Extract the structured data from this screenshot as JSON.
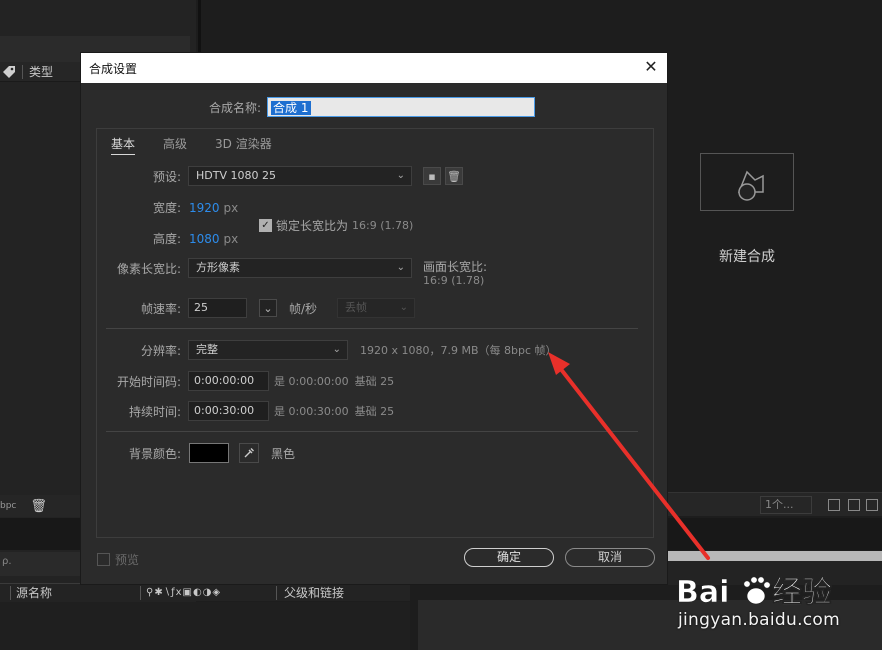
{
  "background": {
    "type_header": "类型",
    "bpc_label": "bpc",
    "timeline_col_source": "源名称",
    "timeline_col_parent": "父级和链接",
    "toolbar_dropdown": "1个...",
    "new_comp_label": "新建合成",
    "search_hint": "ρ."
  },
  "dialog": {
    "title": "合成设置",
    "name_label": "合成名称:",
    "name_value": "合成 1",
    "tabs": [
      {
        "label": "基本",
        "active": true
      },
      {
        "label": "高级",
        "active": false
      },
      {
        "label": "3D 渲染器",
        "active": false
      }
    ],
    "preset": {
      "label": "预设:",
      "value": "HDTV 1080 25"
    },
    "width": {
      "label": "宽度:",
      "value": "1920",
      "unit": "px"
    },
    "height": {
      "label": "高度:",
      "value": "1080",
      "unit": "px"
    },
    "lock_aspect": {
      "label": "锁定长宽比为",
      "value": "16:9 (1.78)",
      "checked": true
    },
    "pixel_aspect": {
      "label": "像素长宽比:",
      "value": "方形像素"
    },
    "frame_aspect": {
      "label": "画面长宽比:",
      "value": "16:9 (1.78)"
    },
    "frame_rate": {
      "label": "帧速率:",
      "value": "25",
      "unit": "帧/秒",
      "drop_frame": "丢帧"
    },
    "resolution": {
      "label": "分辨率:",
      "value": "完整",
      "info": "1920 x 1080，7.9 MB（每 8bpc 帧）"
    },
    "start_timecode": {
      "label": "开始时间码:",
      "value": "0:00:00:00",
      "info_is": "是 0:00:00:00",
      "info_base": "基础 25"
    },
    "duration": {
      "label": "持续时间:",
      "value": "0:00:30:00",
      "info_is": "是 0:00:30:00",
      "info_base": "基础 25"
    },
    "bg_color": {
      "label": "背景颜色:",
      "name": "黑色",
      "color": "#000000"
    },
    "preview_label": "预览",
    "ok_label": "确定",
    "cancel_label": "取消"
  },
  "watermark": {
    "brand": "Baidu经验",
    "url": "jingyan.baidu.com"
  },
  "colors": {
    "accent_blue": "#2d8ceb",
    "annotation_red": "#e8302a"
  }
}
